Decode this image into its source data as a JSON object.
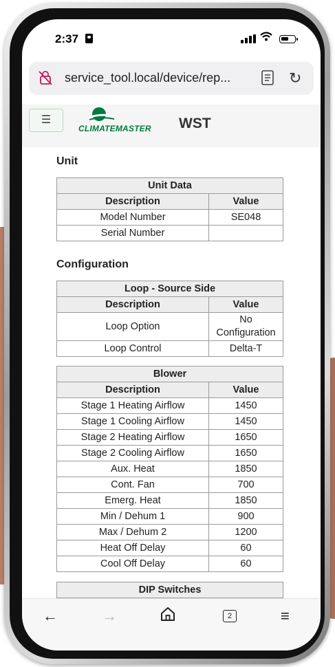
{
  "status": {
    "time": "2:37"
  },
  "browser": {
    "url": "service_tool.local/device/rep...",
    "tab_count": "2"
  },
  "site": {
    "logo_text": "CLIMATEMASTER",
    "title": "WST"
  },
  "sections": {
    "unit": "Unit",
    "configuration": "Configuration"
  },
  "unit_table": {
    "title": "Unit Data",
    "headers": [
      "Description",
      "Value"
    ],
    "rows": [
      [
        "Model Number",
        "SE048"
      ],
      [
        "Serial Number",
        ""
      ]
    ]
  },
  "loop_table": {
    "title": "Loop - Source Side",
    "headers": [
      "Description",
      "Value"
    ],
    "rows": [
      [
        "Loop Option",
        "No Configuration"
      ],
      [
        "Loop Control",
        "Delta-T"
      ]
    ]
  },
  "blower_table": {
    "title": "Blower",
    "headers": [
      "Description",
      "Value"
    ],
    "rows": [
      [
        "Stage 1 Heating Airflow",
        "1450"
      ],
      [
        "Stage 1 Cooling Airflow",
        "1450"
      ],
      [
        "Stage 2 Heating Airflow",
        "1650"
      ],
      [
        "Stage 2 Cooling Airflow",
        "1650"
      ],
      [
        "Aux. Heat",
        "1850"
      ],
      [
        "Cont. Fan",
        "700"
      ],
      [
        "Emerg. Heat",
        "1850"
      ],
      [
        "Min / Dehum 1",
        "900"
      ],
      [
        "Max / Dehum 2",
        "1200"
      ],
      [
        "Heat Off Delay",
        "60"
      ],
      [
        "Cool Off Delay",
        "60"
      ]
    ]
  },
  "dip_table": {
    "title": "DIP Switches"
  },
  "toolbar_icons": [
    "back-arrow-icon",
    "forward-arrow-icon",
    "home-icon",
    "tabs-icon",
    "menu-icon"
  ],
  "colors": {
    "brand_green": "#007a3d",
    "table_header_bg": "#ededed"
  }
}
